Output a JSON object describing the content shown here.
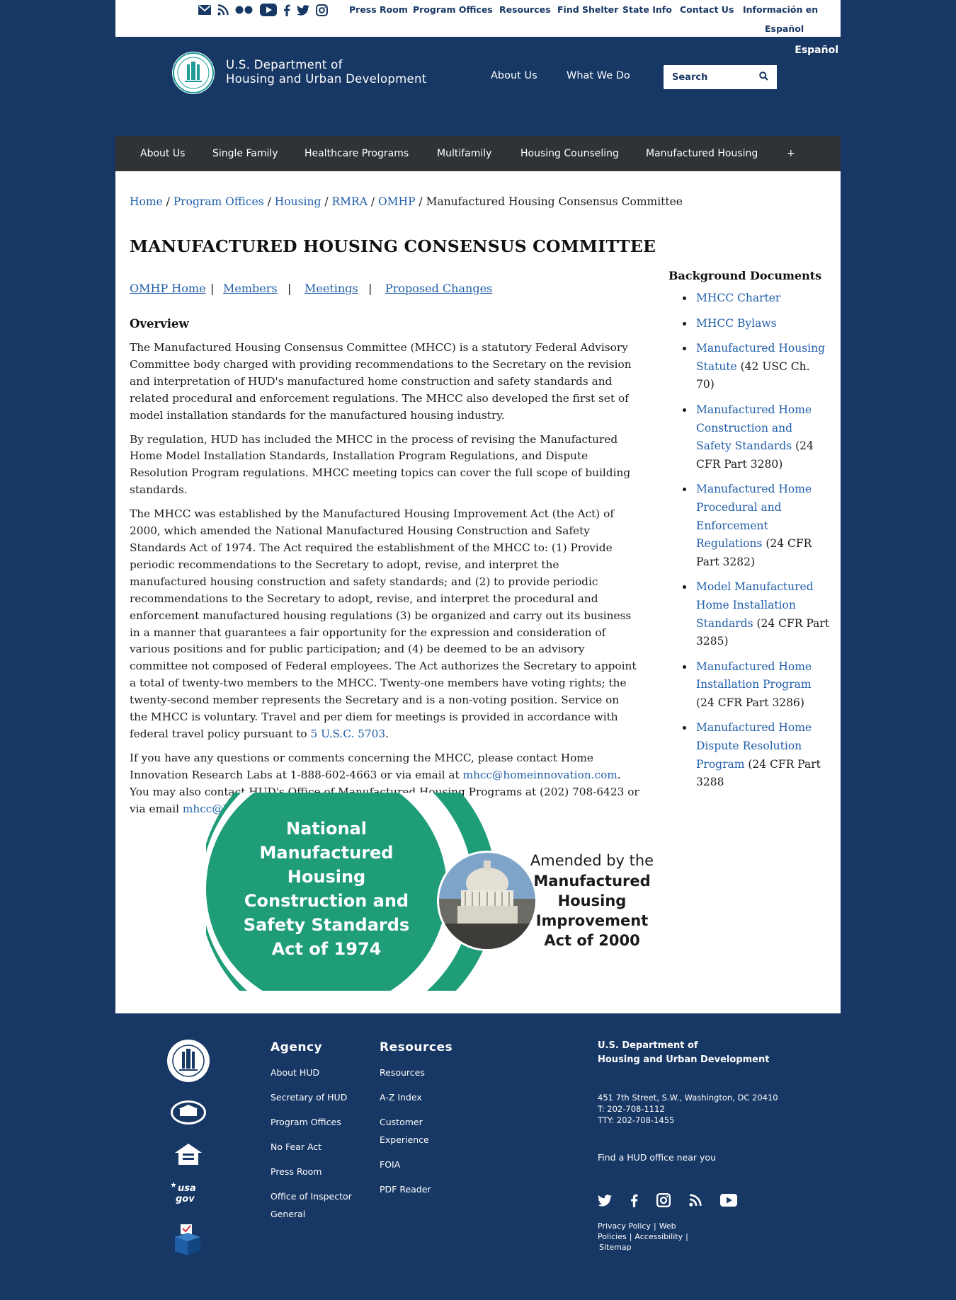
{
  "top_links": [
    "Press Room",
    "Program Offices",
    "Resources",
    "Find Shelter",
    "State Info",
    "Contact Us",
    "Información en",
    "Español"
  ],
  "espanol": "Español",
  "header": {
    "title_line1": "U.S. Department of",
    "title_line2": "Housing and Urban Development",
    "about": "About Us",
    "what_we_do": "What We Do",
    "search_placeholder": "Search"
  },
  "main_nav": [
    "About Us",
    "Single Family",
    "Healthcare Programs",
    "Multifamily",
    "Housing Counseling",
    "Manufactured Housing",
    "+"
  ],
  "breadcrumb": {
    "links": [
      "Home",
      "Program Offices",
      "Housing",
      "RMRA",
      "OMHP"
    ],
    "current": "Manufactured Housing Consensus Committee"
  },
  "page_title": "MANUFACTURED HOUSING CONSENSUS COMMITTEE",
  "subnav": [
    "OMHP Home",
    "Members",
    "Meetings",
    "Proposed Changes"
  ],
  "subnav_sep": "|",
  "overview_heading": "Overview",
  "paragraphs": {
    "p1": "The Manufactured Housing Consensus Committee (MHCC) is a statutory Federal Advisory Committee body charged with providing recommendations to the Secretary on the revision and interpretation of HUD's manufactured home construction and safety standards and related procedural and enforcement regulations. The MHCC also developed the first set of model installation standards for the manufactured housing industry.",
    "p2": "By regulation, HUD has included the MHCC in the process of revising the Manufactured Home Model Installation Standards, Installation Program Regulations, and Dispute Resolution Program regulations.  MHCC meeting topics can cover the full scope of building standards.",
    "p3": "The MHCC was established by the Manufactured Housing Improvement Act (the Act) of 2000, which amended the National Manufactured Housing Construction and Safety Standards Act of 1974. The Act required the establishment of the MHCC to: (1) Provide periodic recommendations to the Secretary to adopt, revise, and interpret the manufactured housing construction and safety standards; and (2) to provide periodic recommendations to the Secretary to adopt, revise, and interpret the procedural and enforcement manufactured housing regulations (3) be organized and carry out its business in a manner that guarantees a fair opportunity for the expression and consideration of various positions and for public participation; and (4) be deemed to be an advisory committee not composed of Federal employees.  The Act authorizes the Secretary to appoint a total of twenty-two members to the MHCC. Twenty-one members have voting rights; the twenty-second member represents the Secretary and is a non-voting position. Service on the MHCC is voluntary. Travel and per diem for meetings is provided in accordance with federal travel policy pursuant to ",
    "p3_link": "5 U.S.C. 5703",
    "p3_end": ".",
    "p4a": "If you have any questions or comments concerning the MHCC, please contact Home Innovation Research Labs at 1-888-602-4663 or via email at ",
    "p4_email1": "mhcc@homeinnovation.com",
    "p4b": ". You may also contact HUD's Office of Manufactured Housing Programs at (202) 708-6423 or via email ",
    "p4_email2": "mhcc@hud.gov",
    "p4c": "."
  },
  "sidebar": {
    "heading": "Background Documents",
    "items": [
      {
        "link": "MHCC Charter",
        "suffix": ""
      },
      {
        "link": "MHCC Bylaws",
        "suffix": ""
      },
      {
        "link": "Manufactured Housing Statute",
        "suffix": " (42 USC Ch. 70)"
      },
      {
        "link": "Manufactured Home Construction and Safety Standards",
        "suffix": " (24 CFR Part 3280)"
      },
      {
        "link": "Manufactured Home Procedural and Enforcement Regulations",
        "suffix": " (24 CFR Part 3282)"
      },
      {
        "link": "Model Manufactured Home Installation Standards",
        "suffix": " (24 CFR Part 3285)"
      },
      {
        "link": "Manufactured Home Installation Program",
        "suffix": " (24 CFR Part 3286)"
      },
      {
        "link": "Manufactured Home Dispute Resolution Program",
        "suffix": " (24 CFR Part 3288"
      }
    ]
  },
  "infographic": {
    "left_lines": [
      "National",
      "Manufactured",
      "Housing",
      "Construction and",
      "Safety Standards",
      "Act of 1974"
    ],
    "right_line1": "Amended by the",
    "right_lines_bold": [
      "Manufactured",
      "Housing",
      "Improvement",
      "Act of 2000"
    ]
  },
  "footer": {
    "agency_heading": "Agency",
    "agency_links": [
      "About HUD",
      "Secretary of HUD",
      "Program Offices",
      "No Fear Act",
      "Press Room",
      "Office of Inspector",
      "General"
    ],
    "resources_heading": "Resources",
    "resources_links": [
      "Resources",
      "A-Z Index",
      "Customer",
      "Experience",
      "FOIA",
      "PDF Reader"
    ],
    "name_line1": "U.S. Department of",
    "name_line2": "Housing and Urban Development",
    "address": "451 7th Street, S.W., Washington, DC 20410",
    "phone": "T: 202-708-1112",
    "tty": "TTY: 202-708-1455",
    "find_office": "Find a HUD office near you",
    "policy_links": [
      "Privacy Policy",
      "Web Policies",
      "Accessibility",
      "Sitemap"
    ],
    "policy_sep": "|",
    "usagov": "usa gov"
  },
  "colors": {
    "navy": "#173764",
    "nav_dark": "#2f3336",
    "link_blue": "#1f5da8",
    "green": "#1f9c78"
  },
  "icons": [
    "email-icon",
    "rss-icon",
    "flickr-icon",
    "youtube-icon",
    "facebook-icon",
    "twitter-icon",
    "instagram-icon",
    "search-icon"
  ]
}
